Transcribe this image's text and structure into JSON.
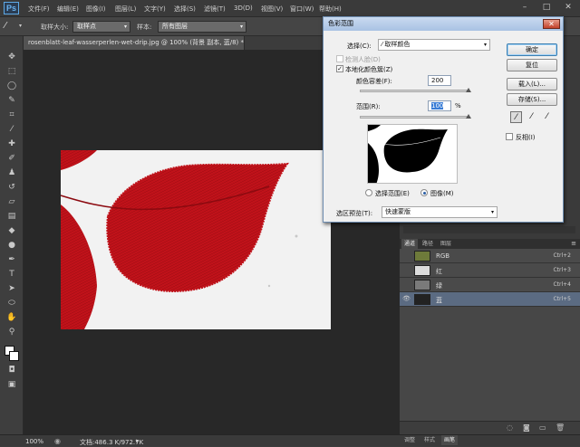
{
  "app": {
    "logo": "Ps"
  },
  "menu": [
    "文件(F)",
    "编辑(E)",
    "图像(I)",
    "图层(L)",
    "文字(Y)",
    "选择(S)",
    "滤镜(T)",
    "3D(D)",
    "视图(V)",
    "窗口(W)",
    "帮助(H)"
  ],
  "window_controls": {
    "minimize": "–",
    "maximize": "□",
    "close": "✕"
  },
  "options": {
    "sample_size_label": "取样大小:",
    "sample_size_value": "取样点",
    "sample_label": "样本:",
    "sample_value": "所有图层"
  },
  "document": {
    "tab_title": "rosenblatt-leaf-wasserperlen-wet-drip.jpg @ 100% (背景 副本, 蓝/8) *",
    "tab_close": "×"
  },
  "status": {
    "zoom": "100%",
    "doc_info": "文档:486.3 K/972.7K"
  },
  "panel": {
    "tabs": [
      "通道",
      "路径",
      "图层"
    ],
    "channels": [
      {
        "name": "RGB",
        "shortcut": "Ctrl+2",
        "visible": false
      },
      {
        "name": "红",
        "shortcut": "Ctrl+3",
        "visible": false
      },
      {
        "name": "绿",
        "shortcut": "Ctrl+4",
        "visible": false
      },
      {
        "name": "蓝",
        "shortcut": "Ctrl+5",
        "visible": true
      }
    ],
    "bottom_tabs": [
      "调整",
      "样式",
      "画笔"
    ]
  },
  "dialog": {
    "title": "色彩范围",
    "close_glyph": "✕",
    "select_label": "选择(C):",
    "select_value": "取样颜色",
    "detect_faces_label": "检测人脸(D)",
    "localized_label": "本地化颜色簇(Z)",
    "fuzziness_label": "颜色容差(F):",
    "fuzziness_value": "200",
    "range_label": "范围(R):",
    "range_value": "100",
    "range_unit": "%",
    "fuzziness_level": 1.0,
    "range_level": 1.0,
    "radio_selection": "选择范围(E)",
    "radio_image": "图像(M)",
    "preview_label": "选区预览(T):",
    "preview_value": "快速蒙版",
    "buttons": {
      "ok": "确定",
      "reset": "复位",
      "load": "载入(L)...",
      "save": "存储(S)..."
    },
    "invert_label": "反相(I)",
    "checkmark": "✓"
  },
  "colors": {
    "leaf_red": "#c0121a",
    "dialog_bg": "#f0f0f0",
    "panel_selected": "#5b6b82",
    "titlebar": "#b6cbe8"
  }
}
